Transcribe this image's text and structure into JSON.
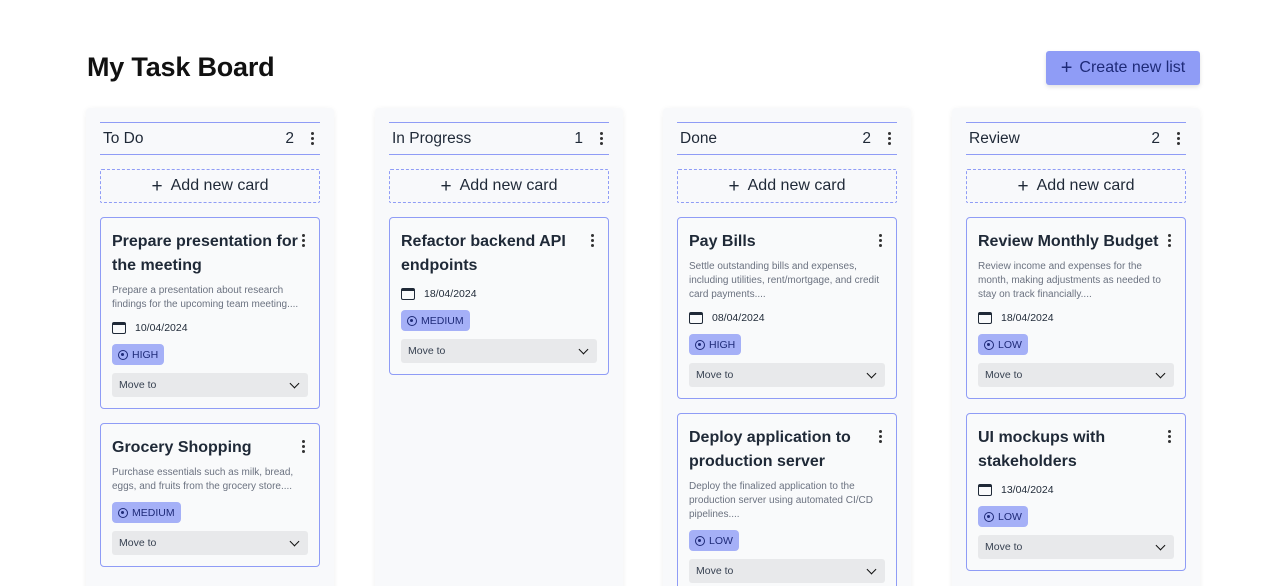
{
  "page": {
    "title": "My Task Board",
    "create_button_label": "Create new list"
  },
  "add_card_label": "Add new card",
  "move_to_label": "Move to",
  "colors": {
    "accent": "#8f9cf6",
    "badge": "#a5b0f7"
  },
  "columns": [
    {
      "title": "To Do",
      "count": "2",
      "cards": [
        {
          "title": "Prepare presentation for the meeting",
          "description": "Prepare a presentation about research findings for the upcoming team meeting....",
          "date": "10/04/2024",
          "priority": "HIGH"
        },
        {
          "title": "Grocery Shopping",
          "description": "Purchase essentials such as milk, bread, eggs, and fruits from the grocery store....",
          "date": "",
          "priority": "MEDIUM"
        }
      ]
    },
    {
      "title": "In Progress",
      "count": "1",
      "cards": [
        {
          "title": "Refactor backend API endpoints",
          "description": "",
          "date": "18/04/2024",
          "priority": "MEDIUM"
        }
      ]
    },
    {
      "title": "Done",
      "count": "2",
      "cards": [
        {
          "title": "Pay Bills",
          "description": "Settle outstanding bills and expenses, including utilities, rent/mortgage, and credit card payments....",
          "date": "08/04/2024",
          "priority": "HIGH"
        },
        {
          "title": "Deploy application to production server",
          "description": "Deploy the finalized application to the production server using automated CI/CD pipelines....",
          "date": "",
          "priority": "LOW"
        }
      ]
    },
    {
      "title": "Review",
      "count": "2",
      "cards": [
        {
          "title": "Review Monthly Budget",
          "description": "Review income and expenses for the month, making adjustments as needed to stay on track financially....",
          "date": "18/04/2024",
          "priority": "LOW"
        },
        {
          "title": "UI mockups with stakeholders",
          "description": "",
          "date": "13/04/2024",
          "priority": "LOW"
        }
      ]
    }
  ]
}
